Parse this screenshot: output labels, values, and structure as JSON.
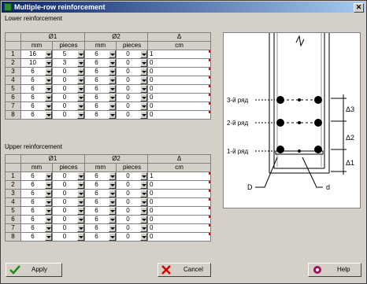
{
  "window": {
    "title": "Multiple-row reinforcement",
    "close": "✕"
  },
  "lower": {
    "label": "Lower reinforcement",
    "headers": {
      "d1": "Ø1",
      "d2": "Ø2",
      "delta": "Δ",
      "mm": "mm",
      "pieces": "pieces",
      "cm": "cm"
    },
    "rows": [
      {
        "n": "1",
        "mm1": "16",
        "pc1": "5",
        "mm2": "6",
        "pc2": "0",
        "cm": "1"
      },
      {
        "n": "2",
        "mm1": "10",
        "pc1": "3",
        "mm2": "6",
        "pc2": "0",
        "cm": "0"
      },
      {
        "n": "3",
        "mm1": "6",
        "pc1": "0",
        "mm2": "6",
        "pc2": "0",
        "cm": "0"
      },
      {
        "n": "4",
        "mm1": "6",
        "pc1": "0",
        "mm2": "6",
        "pc2": "0",
        "cm": "0"
      },
      {
        "n": "5",
        "mm1": "6",
        "pc1": "0",
        "mm2": "6",
        "pc2": "0",
        "cm": "0"
      },
      {
        "n": "6",
        "mm1": "6",
        "pc1": "0",
        "mm2": "6",
        "pc2": "0",
        "cm": "0"
      },
      {
        "n": "7",
        "mm1": "6",
        "pc1": "0",
        "mm2": "6",
        "pc2": "0",
        "cm": "0"
      },
      {
        "n": "8",
        "mm1": "6",
        "pc1": "0",
        "mm2": "6",
        "pc2": "0",
        "cm": "0"
      }
    ]
  },
  "upper": {
    "label": "Upper reinforcement",
    "headers": {
      "d1": "Ø1",
      "d2": "Ø2",
      "delta": "Δ",
      "mm": "mm",
      "pieces": "pieces",
      "cm": "cm"
    },
    "rows": [
      {
        "n": "1",
        "mm1": "6",
        "pc1": "0",
        "mm2": "6",
        "pc2": "0",
        "cm": "1"
      },
      {
        "n": "2",
        "mm1": "6",
        "pc1": "0",
        "mm2": "6",
        "pc2": "0",
        "cm": "0"
      },
      {
        "n": "3",
        "mm1": "6",
        "pc1": "0",
        "mm2": "6",
        "pc2": "0",
        "cm": "0"
      },
      {
        "n": "4",
        "mm1": "6",
        "pc1": "0",
        "mm2": "6",
        "pc2": "0",
        "cm": "0"
      },
      {
        "n": "5",
        "mm1": "6",
        "pc1": "0",
        "mm2": "6",
        "pc2": "0",
        "cm": "0"
      },
      {
        "n": "6",
        "mm1": "6",
        "pc1": "0",
        "mm2": "6",
        "pc2": "0",
        "cm": "0"
      },
      {
        "n": "7",
        "mm1": "6",
        "pc1": "0",
        "mm2": "6",
        "pc2": "0",
        "cm": "0"
      },
      {
        "n": "8",
        "mm1": "6",
        "pc1": "0",
        "mm2": "6",
        "pc2": "0",
        "cm": "0"
      }
    ]
  },
  "diagram": {
    "row3": "3-й ряд",
    "row2": "2-й ряд",
    "row1": "1-й ряд",
    "delta3": "Δ3",
    "delta2": "Δ2",
    "delta1": "Δ1",
    "D": "D",
    "d": "d"
  },
  "buttons": {
    "apply": "Apply",
    "cancel": "Cancel",
    "help": "Help"
  },
  "icons": {
    "apply": "checkmark-icon",
    "cancel": "cross-icon",
    "help": "help-icon"
  }
}
